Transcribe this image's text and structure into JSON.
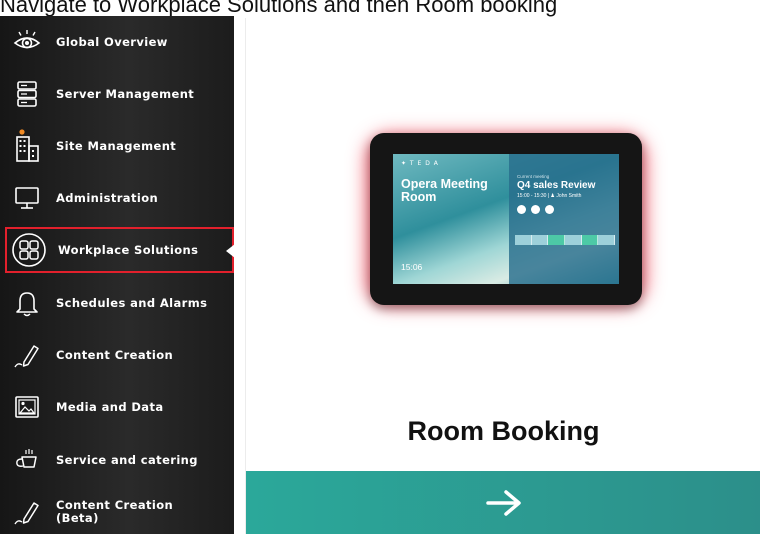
{
  "instruction": "Navigate to Workplace Solutions and then Room booking",
  "sidebar": {
    "items": [
      {
        "label": "Global Overview",
        "icon": "eye-icon"
      },
      {
        "label": "Server Management",
        "icon": "server-icon"
      },
      {
        "label": "Site Management",
        "icon": "building-icon"
      },
      {
        "label": "Administration",
        "icon": "monitor-icon"
      },
      {
        "label": "Workplace Solutions",
        "icon": "grid-icon",
        "selected": true
      },
      {
        "label": "Schedules and Alarms",
        "icon": "bell-icon"
      },
      {
        "label": "Content Creation",
        "icon": "pen-icon"
      },
      {
        "label": "Media and Data",
        "icon": "image-icon"
      },
      {
        "label": "Service and catering",
        "icon": "coffee-icon"
      },
      {
        "label": "Content Creation\n(Beta)",
        "icon": "pen-icon"
      }
    ]
  },
  "card": {
    "title": "Room Booking",
    "footer_icon": "arrow-right-icon",
    "tablet": {
      "brand": "✦ T E D A",
      "room": "Opera Meeting Room",
      "time": "15:06",
      "event_label": "Current meeting",
      "event_title": "Q4 sales Review",
      "event_time": "15:00 - 15:30  |  ♟ John Smith"
    }
  },
  "colors": {
    "accent_teal": "#2ba89a",
    "highlight_red": "#e2202c",
    "notification_orange": "#f08a24"
  }
}
